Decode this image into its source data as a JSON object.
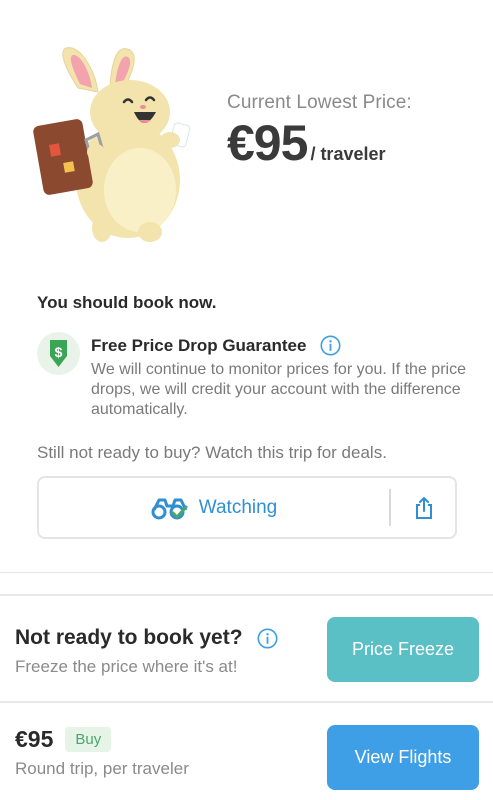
{
  "hero": {
    "mascot_icon": "bunny-with-suitcase-illustration",
    "price_caption": "Current Lowest Price:",
    "price_value": "€95",
    "price_unit": "/ traveler"
  },
  "advice": {
    "text": "You should book now."
  },
  "guarantee": {
    "icon": "shield-dollar-icon",
    "title": "Free Price Drop Guarantee",
    "info_icon": "info-icon",
    "description": "We will continue to monitor prices for you. If the price drops, we will credit your account with the difference automatically."
  },
  "watch": {
    "prompt": "Still not ready to buy? Watch this trip for deals.",
    "icon": "binoculars-check-icon",
    "label": "Watching",
    "share_icon": "share-icon"
  },
  "freeze": {
    "title": "Not ready to book yet?",
    "info_icon": "info-icon",
    "subtitle": "Freeze the price where it's at!",
    "button_label": "Price Freeze"
  },
  "book": {
    "price": "€95",
    "badge": "Buy",
    "subtitle": "Round trip, per traveler",
    "button_label": "View Flights"
  },
  "colors": {
    "accent_blue": "#3e9ee6",
    "teal": "#5bbfc6",
    "green": "#4aa66a",
    "link_blue": "#2f8fd3"
  }
}
